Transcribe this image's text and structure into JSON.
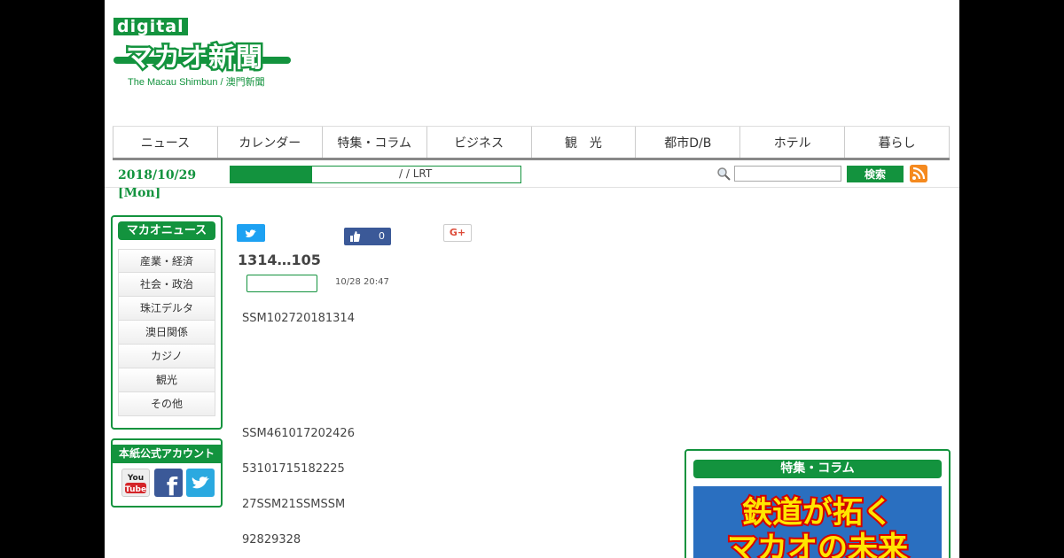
{
  "logo": {
    "digital": "digital",
    "name_jp": "マカオ新聞",
    "subtitle": "The Macau Shimbun / 澳門新聞"
  },
  "nav": [
    {
      "label": "ニュース"
    },
    {
      "label": "カレンダー"
    },
    {
      "label": "特集・コラム"
    },
    {
      "label": "ビジネス"
    },
    {
      "label": "観　光"
    },
    {
      "label": "都市D/B"
    },
    {
      "label": "ホテル"
    },
    {
      "label": "暮らし"
    }
  ],
  "dateline": {
    "date": "2018/10/29",
    "weekday": "[Mon]"
  },
  "ticker": {
    "text": "/  / LRT"
  },
  "search": {
    "button": "検索",
    "value": ""
  },
  "sidebar": {
    "news_title": "マカオニュース",
    "news_items": [
      {
        "label": "産業・経済"
      },
      {
        "label": "社会・政治"
      },
      {
        "label": "珠江デルタ"
      },
      {
        "label": "澳日関係"
      },
      {
        "label": "カジノ"
      },
      {
        "label": "観光"
      },
      {
        "label": "その他"
      }
    ],
    "account_title": "本紙公式アカウント",
    "accounts": [
      {
        "name": "youtube-icon",
        "label": "You Tube"
      },
      {
        "name": "facebook-icon",
        "label": "f"
      },
      {
        "name": "twitter-icon",
        "label": ""
      }
    ]
  },
  "article": {
    "like_count": "0",
    "gplus": "G+",
    "headline": "1314…105",
    "timestamp": "10/28 20:47",
    "paragraphs": [
      "SSM102720181314",
      "SSM461017202426",
      "53101715182225",
      "27SSM21SSMSSM",
      "92829328"
    ]
  },
  "feature": {
    "title": "特集・コラム",
    "banner_line1": "鉄道が拓く",
    "banner_line2": "マカオの未来"
  },
  "colors": {
    "brand": "#13933e",
    "twitter": "#1da1f2",
    "facebook": "#3b5998",
    "rss": "#f58a1f"
  }
}
